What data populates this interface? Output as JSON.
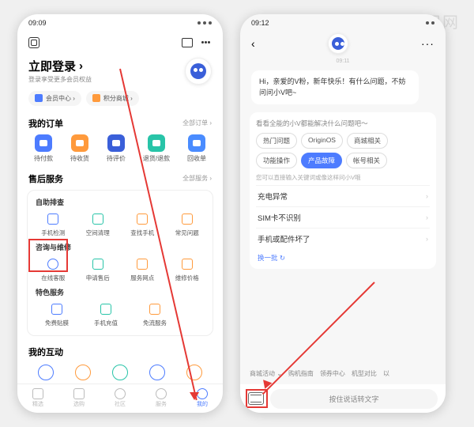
{
  "watermark": "爱创根知识网",
  "phone1": {
    "status_time": "09:09",
    "login_title": "立即登录",
    "login_arrow": "›",
    "login_sub": "登录享受更多会员权益",
    "pill_member": "会员中心 ›",
    "pill_points": "积分商城 ›",
    "orders_title": "我的订单",
    "orders_more": "全部订单 ›",
    "orders": [
      "待付款",
      "待收货",
      "待评价",
      "退货/退款",
      "回收单"
    ],
    "aftersale_title": "售后服务",
    "aftersale_more": "全部服务 ›",
    "selfcheck_title": "自助排查",
    "selfcheck": [
      "手机检测",
      "空间清理",
      "查找手机",
      "常见问题"
    ],
    "consult_title": "咨询与维修",
    "consult": [
      "在线客服",
      "申请售后",
      "服务网点",
      "维修价格"
    ],
    "special_title": "特色服务",
    "special": [
      "免费贴膜",
      "手机充值",
      "免流服务"
    ],
    "interact_title": "我的互动",
    "tabs": [
      "精选",
      "选购",
      "社区",
      "服务",
      "我的"
    ]
  },
  "phone2": {
    "status_time": "09:12",
    "chat_time": "09:11",
    "greeting": "Hi，亲爱的V粉，新年快乐！有什么问题，不妨问问小V吧~",
    "help_title": "看看全能的小V都能解决什么问题吧～",
    "chips_row1": [
      "热门问题",
      "OriginOS",
      "商城相关"
    ],
    "chips_row2": [
      "功能操作",
      "产品故障",
      "帐号相关"
    ],
    "faq_sub": "您可以直接输入关键词或像这样问小V哦",
    "faq": [
      "充电异常",
      "SIM卡不识别",
      "手机或配件坏了"
    ],
    "refresh": "换一批 ↻",
    "quick": [
      "商城活动 ⌄",
      "购机指南",
      "领券中心",
      "机型对比",
      "以"
    ],
    "voice_placeholder": "按住说话转文字"
  }
}
